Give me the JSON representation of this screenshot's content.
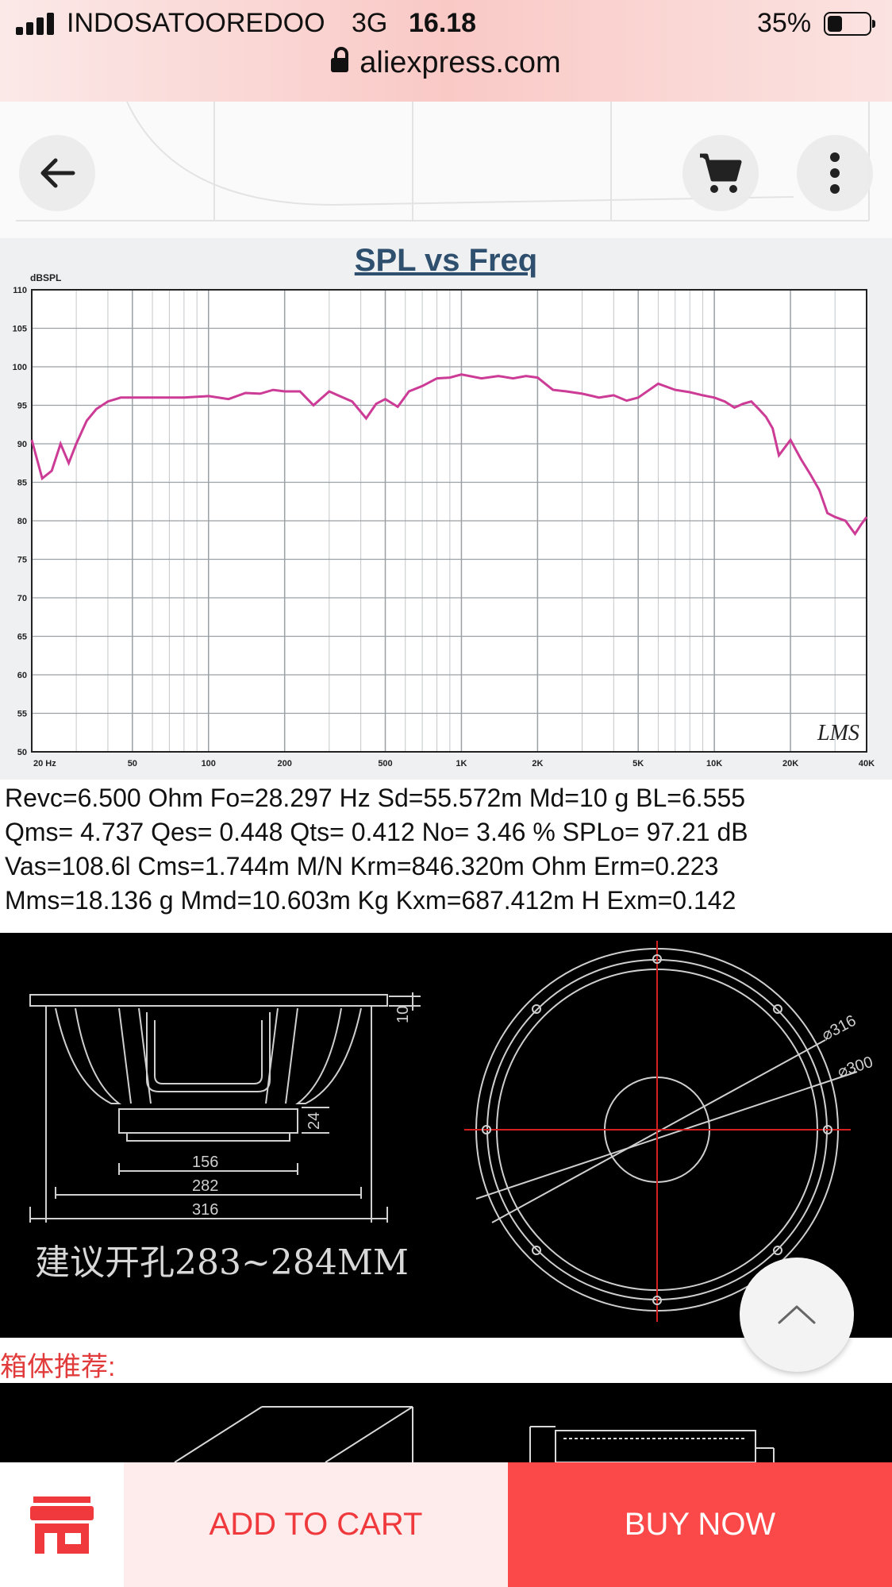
{
  "status_bar": {
    "carrier": "INDOSATOOREDOO",
    "network": "3G",
    "time": "16.18",
    "battery_percent": "35%",
    "battery_level": 0.35
  },
  "address_bar": {
    "url": "aliexpress.com"
  },
  "icons": {
    "back": "arrow-left-icon",
    "cart": "cart-icon",
    "menu": "more-vertical-icon",
    "scroll_top": "chevron-up-icon",
    "store": "store-icon",
    "lock": "lock-icon"
  },
  "colors": {
    "accent_red": "#fb4848",
    "cart_text": "#f0393c",
    "curve": "#cc3b96",
    "title_blue": "#2f4f6e"
  },
  "chart_data": {
    "type": "line",
    "title": "SPL vs Freq",
    "ylabel": "dBSPL",
    "x_scale": "log",
    "xlim": [
      20,
      40000
    ],
    "ylim": [
      50,
      110
    ],
    "x_tick_labels": [
      "20 Hz",
      "50",
      "100",
      "200",
      "500",
      "1K",
      "2K",
      "5K",
      "10K",
      "20K",
      "40K"
    ],
    "y_tick_labels": [
      "50",
      "55",
      "60",
      "65",
      "70",
      "75",
      "80",
      "85",
      "90",
      "95",
      "100",
      "105",
      "110"
    ],
    "watermark": "LMS",
    "grid": true,
    "series": [
      {
        "x": [
          20,
          22,
          24,
          26,
          28,
          30,
          33,
          36,
          40,
          45,
          50,
          60,
          70,
          80,
          100,
          120,
          140,
          160,
          180,
          200,
          230,
          260,
          300,
          330,
          370,
          420,
          460,
          500,
          560,
          620,
          700,
          800,
          900,
          1000,
          1200,
          1400,
          1600,
          1800,
          2000,
          2300,
          2600,
          3000,
          3300,
          3500,
          4000,
          4500,
          5000,
          6000,
          7000,
          8000,
          9000,
          10000,
          11000,
          12000,
          13000,
          14000,
          15000,
          16000,
          17000,
          18000,
          20000,
          22000,
          24000,
          26000,
          28000,
          30000,
          33000,
          36000,
          38000,
          40000
        ],
        "y": [
          90.5,
          85.5,
          86.5,
          90,
          87.5,
          90,
          93,
          94.5,
          95.5,
          96,
          96,
          96,
          96,
          96,
          96.2,
          95.8,
          96.6,
          96.5,
          97,
          96.8,
          96.8,
          95,
          96.8,
          96.2,
          95.5,
          93.3,
          95.2,
          95.8,
          94.8,
          96.8,
          97.5,
          98.5,
          98.6,
          99,
          98.5,
          98.8,
          98.5,
          98.8,
          98.6,
          97,
          96.8,
          96.5,
          96.2,
          96,
          96.3,
          95.6,
          96,
          97.8,
          97,
          96.7,
          96.3,
          96,
          95.5,
          94.7,
          95.2,
          95.5,
          94.5,
          93.5,
          92,
          88.5,
          90.5,
          88,
          86,
          84,
          81,
          80.5,
          80,
          78.3,
          79.5,
          80.5
        ]
      }
    ]
  },
  "specs": {
    "line1": "Revc=6.500 Ohm  Fo=28.297 Hz  Sd=55.572m Md=10 g BL=6.555",
    "line2": "Qms= 4.737  Qes= 0.448  Qts= 0.412  No= 3.46 %  SPLo= 97.21 dB",
    "line3": "Vas=108.6l  Cms=1.744m M/N  Krm=846.320m Ohm  Erm=0.223",
    "line4": "Mms=18.136 g  Mmd=10.603m Kg  Kxm=687.412m H  Exm=0.142"
  },
  "drawing": {
    "dim_10": "10",
    "dim_24": "24",
    "dim_156": "156",
    "dim_282": "282",
    "dim_316": "316",
    "dia_316": "⌀316",
    "dia_300": "⌀300",
    "cutout_note": "建议开孔283~284MM"
  },
  "enclosure_label": "箱体推荐:",
  "actions": {
    "add_to_cart": "ADD TO CART",
    "buy_now": "BUY NOW"
  }
}
